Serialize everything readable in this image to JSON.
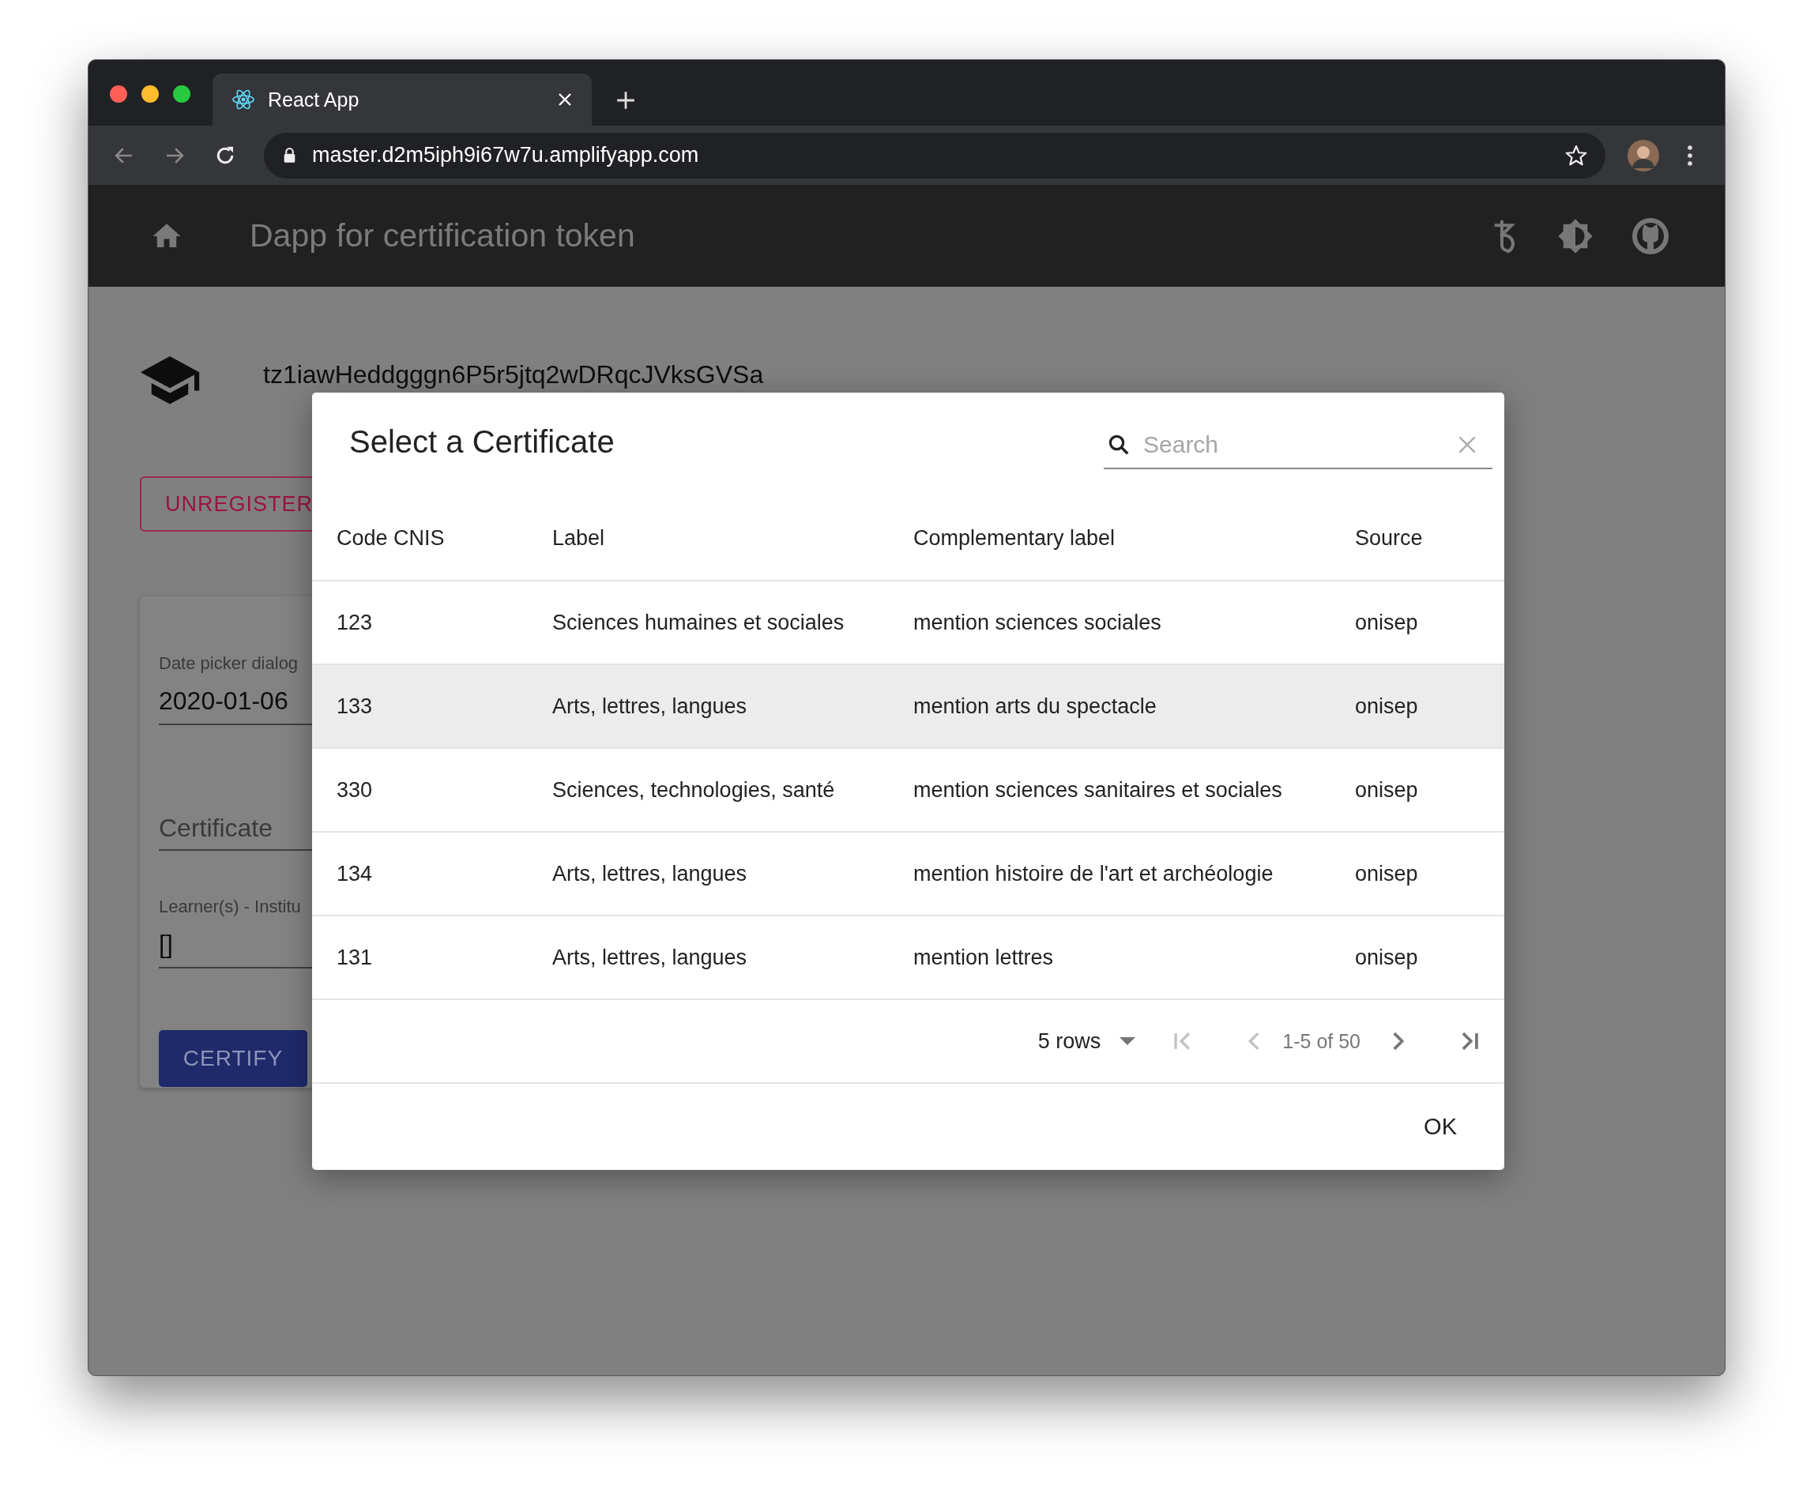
{
  "browser": {
    "tab": {
      "title": "React App"
    },
    "url": "master.d2m5iph9i67w7u.amplifyapp.com"
  },
  "app_bar": {
    "title": "Dapp for certification token"
  },
  "page": {
    "account": "tz1iawHeddgggn6P5r5jtq2wDRqcJVksGVSa",
    "unregister_button": "UNREGISTER",
    "form": {
      "date_field": {
        "label": "Date picker dialog",
        "value": "2020-01-06"
      },
      "certificate_field": {
        "placeholder": "Certificate"
      },
      "learners_field": {
        "label": "Learner(s) - Institu",
        "value": "[]"
      },
      "certify_button": "CERTIFY"
    }
  },
  "dialog": {
    "title": "Select a Certificate",
    "search": {
      "placeholder": "Search"
    },
    "table": {
      "columns": [
        "Code CNIS",
        "Label",
        "Complementary label",
        "Source"
      ],
      "rows": [
        {
          "cells": [
            "123",
            "Sciences humaines et sociales",
            "mention sciences sociales",
            "onisep"
          ],
          "selected": false
        },
        {
          "cells": [
            "133",
            "Arts, lettres, langues",
            "mention arts du spectacle",
            "onisep"
          ],
          "selected": true
        },
        {
          "cells": [
            "330",
            "Sciences, technologies, santé",
            "mention sciences sanitaires et sociales",
            "onisep"
          ],
          "selected": false
        },
        {
          "cells": [
            "134",
            "Arts, lettres, langues",
            "mention histoire de l'art et archéologie",
            "onisep"
          ],
          "selected": false
        },
        {
          "cells": [
            "131",
            "Arts, lettres, langues",
            "mention lettres",
            "onisep"
          ],
          "selected": false
        }
      ]
    },
    "pagination": {
      "rows_per_page": "5 rows",
      "range": "1-5 of 50",
      "first_disabled": true,
      "previous_disabled": true,
      "next_disabled": false,
      "last_disabled": false
    },
    "ok_button": "OK"
  }
}
